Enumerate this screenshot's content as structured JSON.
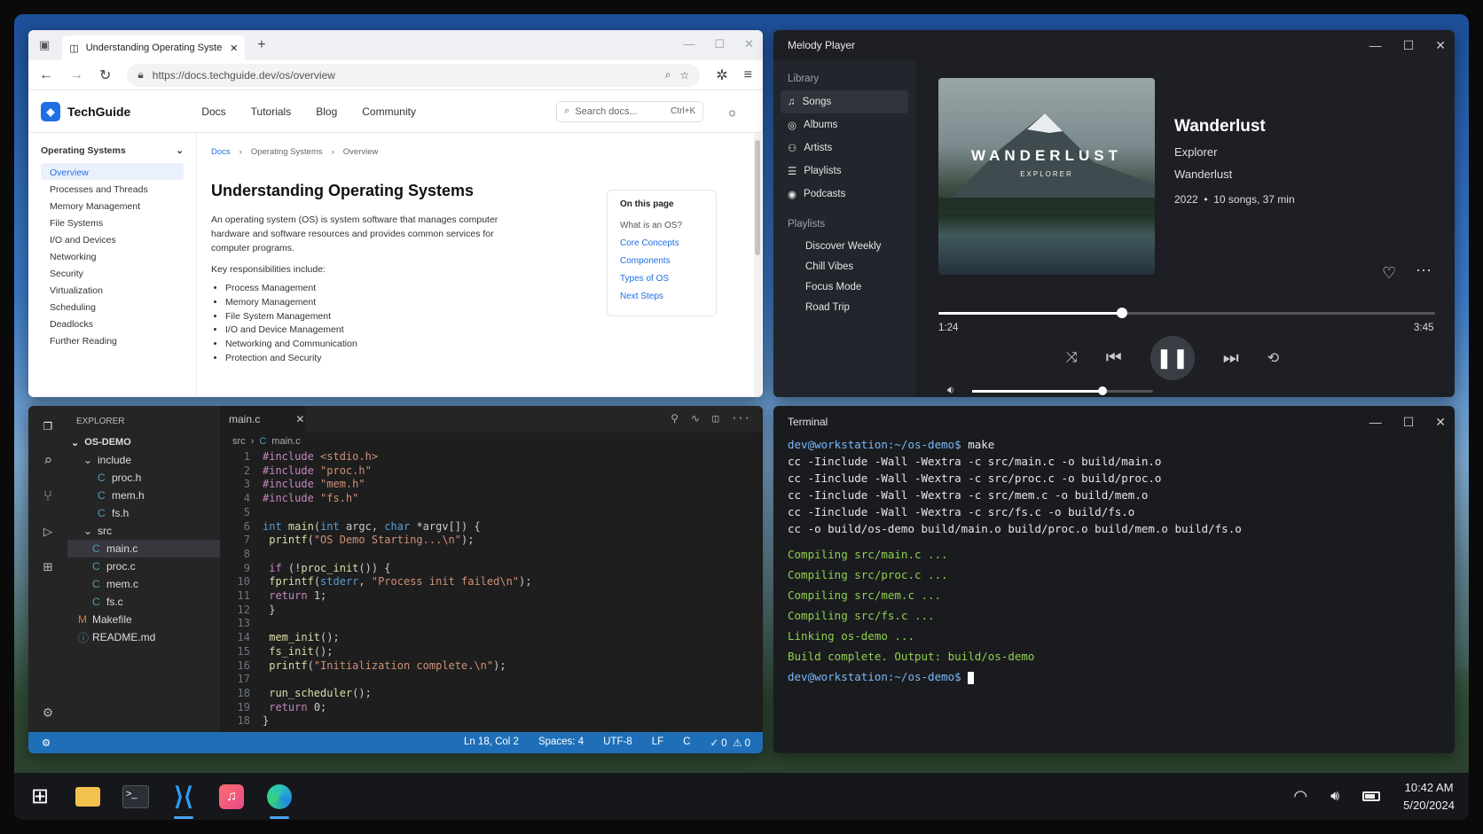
{
  "browser": {
    "tab_title": "Understanding Operating System",
    "url": "https://docs.techguide.dev/os/overview",
    "site_name": "TechGuide",
    "nav": [
      "Docs",
      "Tutorials",
      "Blog",
      "Community"
    ],
    "search_placeholder": "Search docs...",
    "search_shortcut": "Ctrl+K",
    "sidebar_section": "Operating Systems",
    "sidebar_items": [
      "Overview",
      "Processes and Threads",
      "Memory Management",
      "File Systems",
      "I/O and Devices",
      "Networking",
      "Security",
      "Virtualization",
      "Scheduling",
      "Deadlocks",
      "Further Reading"
    ],
    "breadcrumb": [
      "Docs",
      "Operating Systems",
      "Overview"
    ],
    "heading": "Understanding Operating Systems",
    "intro": "An operating system (OS) is system software that manages computer hardware and software resources and provides common services for computer programs.",
    "key_label": "Key responsibilities include:",
    "bullets": [
      "Process Management",
      "Memory Management",
      "File System Management",
      "I/O and Device Management",
      "Networking and Communication",
      "Protection and Security"
    ],
    "toc_title": "On this page",
    "toc": [
      "What is an OS?",
      "Core Concepts",
      "Components",
      "Types of OS",
      "Next Steps"
    ]
  },
  "music": {
    "app_title": "Melody Player",
    "library_label": "Library",
    "library": [
      "Songs",
      "Albums",
      "Artists",
      "Playlists",
      "Podcasts"
    ],
    "playlists_label": "Playlists",
    "playlists": [
      "Discover Weekly",
      "Chill Vibes",
      "Focus Mode",
      "Road Trip"
    ],
    "cover_title": "WANDERLUST",
    "cover_sub": "EXPLORER",
    "track": "Wanderlust",
    "artist": "Explorer",
    "album": "Wanderlust",
    "year": "2022",
    "meta": "10 songs, 37 min",
    "elapsed": "1:24",
    "duration": "3:45",
    "progress": 0.37,
    "volume": 0.72
  },
  "code": {
    "explorer_label": "EXPLORER",
    "project": "OS-DEMO",
    "tab": "main.c",
    "crumb_folder": "src",
    "crumb_file": "main.c",
    "tree": [
      {
        "n": "include",
        "t": "dir"
      },
      {
        "n": "proc.h",
        "t": "c"
      },
      {
        "n": "mem.h",
        "t": "c"
      },
      {
        "n": "fs.h",
        "t": "c"
      },
      {
        "n": "src",
        "t": "dir"
      },
      {
        "n": "main.c",
        "t": "c"
      },
      {
        "n": "proc.c",
        "t": "c"
      },
      {
        "n": "mem.c",
        "t": "c"
      },
      {
        "n": "fs.c",
        "t": "c"
      },
      {
        "n": "Makefile",
        "t": "m"
      },
      {
        "n": "README.md",
        "t": "i"
      }
    ],
    "status": {
      "pos": "Ln 18, Col 2",
      "spaces": "Spaces: 4",
      "enc": "UTF-8",
      "eol": "LF",
      "lang": "C",
      "err": "0",
      "warn": "0"
    }
  },
  "terminal": {
    "title": "Terminal",
    "prompt": "dev@workstation:~/os-demo$",
    "cmd": "make",
    "lines": [
      "cc -Iinclude -Wall -Wextra -c src/main.c -o build/main.o",
      "cc -Iinclude -Wall -Wextra -c src/proc.c -o build/proc.o",
      "cc -Iinclude -Wall -Wextra -c src/mem.c -o build/mem.o",
      "cc -Iinclude -Wall -Wextra -c src/fs.c -o build/fs.o",
      "cc -o build/os-demo build/main.o build/proc.o build/mem.o build/fs.o"
    ],
    "green": [
      "Compiling src/main.c ...",
      "Compiling src/proc.c ...",
      "Compiling src/mem.c ...",
      "Compiling src/fs.c ...",
      "Linking os-demo ...",
      "Build complete. Output: build/os-demo"
    ]
  },
  "taskbar": {
    "time": "10:42 AM",
    "date": "5/20/2024"
  }
}
